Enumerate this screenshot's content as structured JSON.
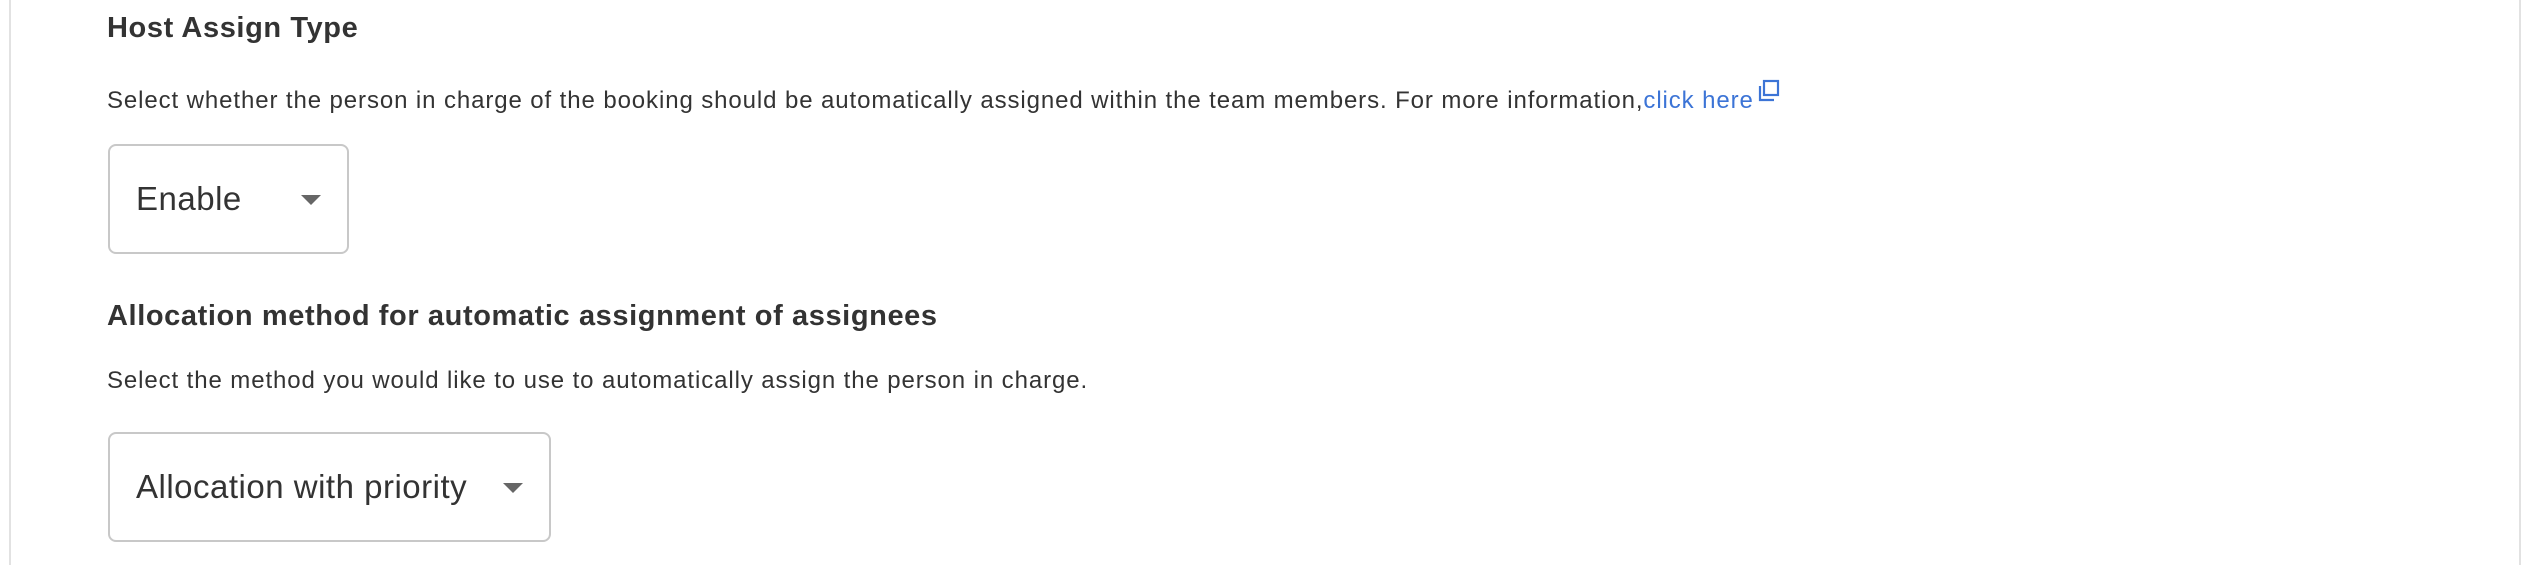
{
  "host_assign": {
    "title": "Host Assign Type",
    "description": "Select whether the person in charge of the booking should be automatically assigned within the team members. For more information,",
    "link_text": "click here",
    "link_icon": "external-link-icon",
    "select_value": "Enable",
    "caret_icon": "caret-down-icon"
  },
  "allocation": {
    "title": "Allocation method for automatic assignment of assignees",
    "description": "Select the method you would like to use to automatically assign the person in charge.",
    "select_value": "Allocation with priority",
    "caret_icon": "caret-down-icon"
  },
  "colors": {
    "link": "#3c74d6",
    "text": "#333333",
    "border": "#c8c8c8"
  }
}
